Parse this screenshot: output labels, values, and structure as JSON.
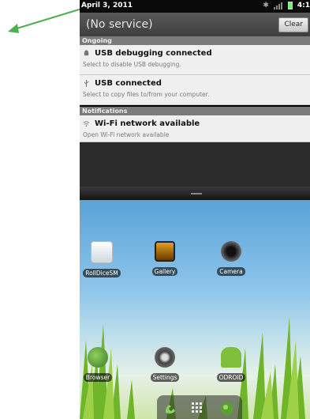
{
  "status_bar": {
    "date": "April 3, 2011",
    "time": "4:1",
    "icons": [
      "bluetooth-icon",
      "signal-icon",
      "battery-icon"
    ]
  },
  "notification_panel": {
    "carrier": "(No service)",
    "clear_label": "Clear",
    "sections": {
      "ongoing": "Ongoing",
      "notifications": "Notifications"
    },
    "ongoing_items": [
      {
        "title": "USB debugging connected",
        "subtitle": "Select to disable USB debugging.",
        "icon": "android-debug-icon"
      },
      {
        "title": "USB connected",
        "subtitle": "Select to copy files to/from your computer.",
        "icon": "usb-icon"
      }
    ],
    "notification_items": [
      {
        "title": "Wi-Fi network available",
        "subtitle": "Open Wi-Fi network available",
        "icon": "wifi-icon"
      }
    ]
  },
  "home_screen": {
    "apps_row1": [
      {
        "label": "RollDiceSM",
        "icon": "dice-app-icon"
      },
      {
        "label": "Gallery",
        "icon": "gallery-icon"
      },
      {
        "label": "Camera",
        "icon": "camera-icon"
      }
    ],
    "apps_row2": [
      {
        "label": "Browser",
        "icon": "browser-globe-icon"
      },
      {
        "label": "Settings",
        "icon": "settings-icon"
      },
      {
        "label": "ODROID",
        "icon": "odroid-android-icon"
      }
    ],
    "dock": [
      "phone-icon",
      "app-drawer-icon",
      "browser-globe-icon"
    ]
  },
  "colors": {
    "accent_arrow": "#4caf50",
    "panel_header": "#4a4a4a",
    "notif_bg": "#f0f0f0"
  }
}
